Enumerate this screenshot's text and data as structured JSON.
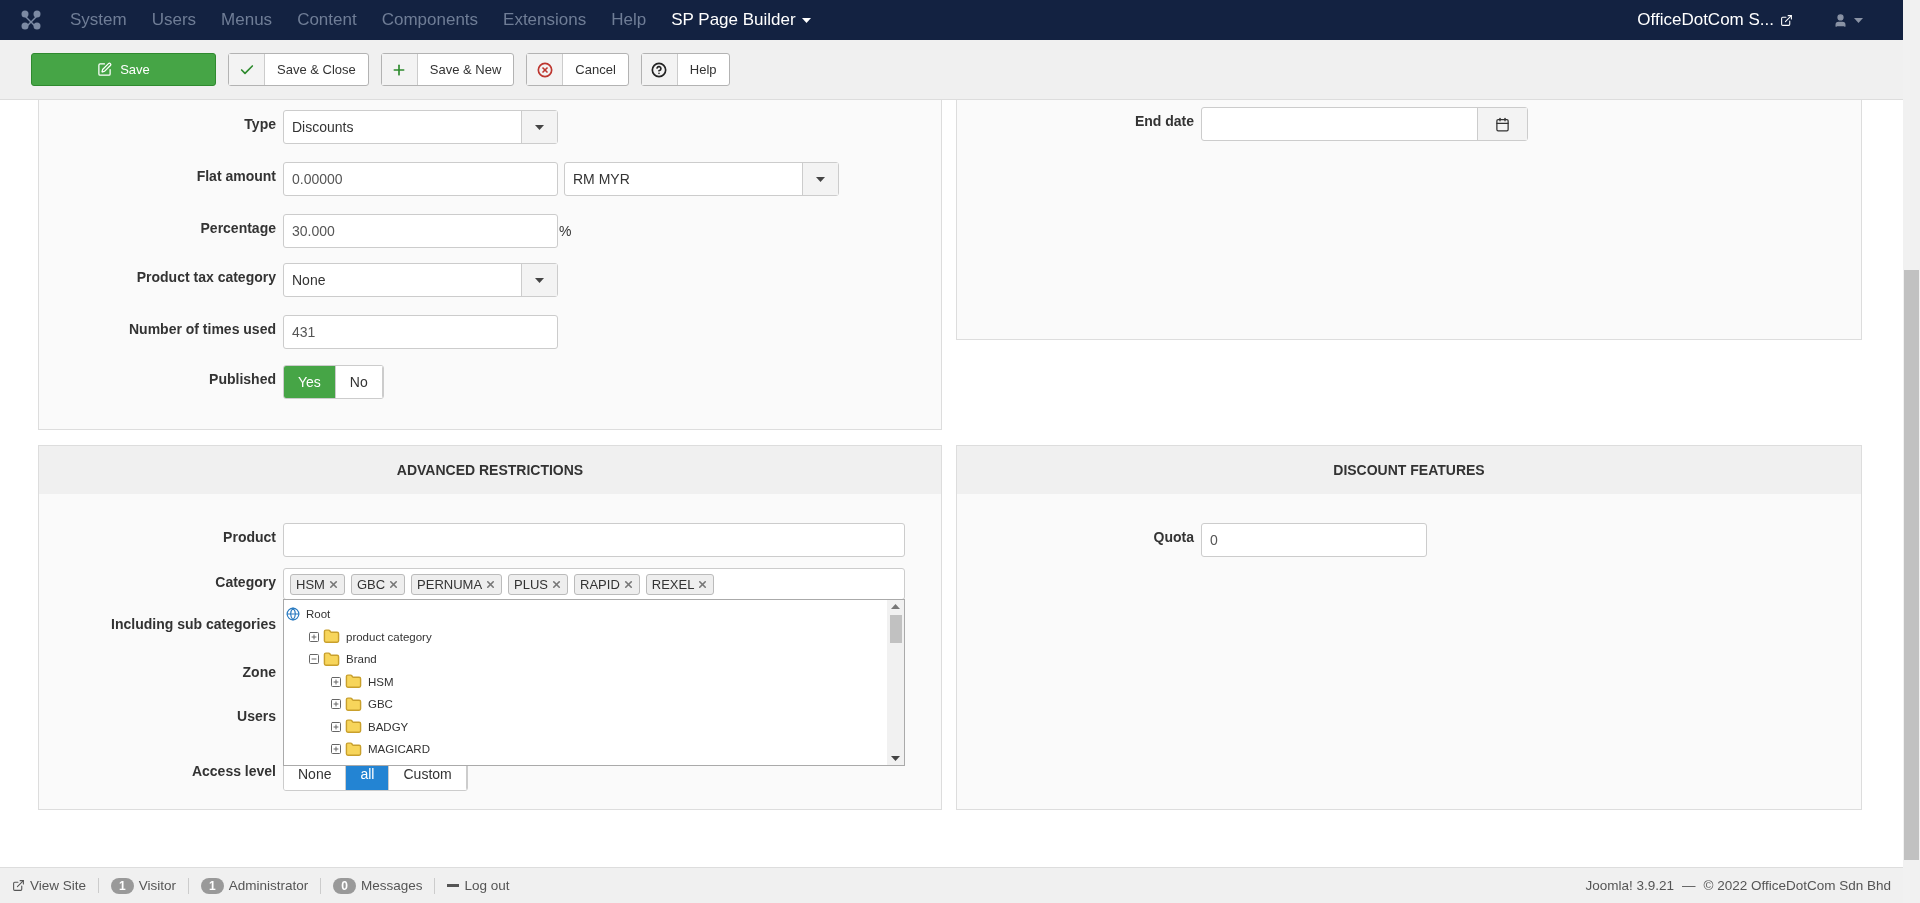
{
  "nav": {
    "menu": [
      {
        "label": "System",
        "disabled": true
      },
      {
        "label": "Users",
        "disabled": true
      },
      {
        "label": "Menus",
        "disabled": true
      },
      {
        "label": "Content",
        "disabled": true
      },
      {
        "label": "Components",
        "disabled": true
      },
      {
        "label": "Extensions",
        "disabled": true
      },
      {
        "label": "Help",
        "disabled": true
      },
      {
        "label": "SP Page Builder",
        "disabled": false
      }
    ],
    "site": "OfficeDotCom S..."
  },
  "toolbar": [
    {
      "kind": "primary",
      "label": "Save"
    },
    {
      "kind": "close",
      "label": "Save & Close"
    },
    {
      "kind": "new",
      "label": "Save & New"
    },
    {
      "kind": "cancel",
      "label": "Cancel"
    },
    {
      "kind": "help",
      "label": "Help"
    }
  ],
  "general": {
    "fields": [
      {
        "kind": "select",
        "label": "Type",
        "value": "Discounts"
      },
      {
        "kind": "amount",
        "label": "Flat amount",
        "value": "0.00000",
        "currency": "RM MYR"
      },
      {
        "kind": "percent",
        "label": "Percentage",
        "value": "30.000",
        "suffix": "%"
      },
      {
        "kind": "select",
        "label": "Product tax category",
        "value": "None"
      },
      {
        "kind": "text",
        "label": "Number of times used",
        "value": "431"
      },
      {
        "kind": "toggle",
        "label": "Published",
        "options": [
          {
            "label": "Yes",
            "selected": true
          },
          {
            "label": "No",
            "selected": false
          }
        ]
      }
    ]
  },
  "dates": {
    "end_date": {
      "label": "End date"
    }
  },
  "advanced": {
    "title": "ADVANCED RESTRICTIONS",
    "product": {
      "label": "Product"
    },
    "category": {
      "label": "Category",
      "tags": [
        "HSM",
        "GBC",
        "PERNUMA",
        "PLUS",
        "RAPID",
        "REXEL"
      ]
    },
    "hidden_labels": [
      "Including sub categories",
      "Zone",
      "Users"
    ],
    "access": {
      "label": "Access level",
      "options": [
        {
          "label": "None",
          "selected": false
        },
        {
          "label": "all",
          "selected": true
        },
        {
          "label": "Custom",
          "selected": false
        }
      ]
    },
    "tree": {
      "label": "Root",
      "children": [
        {
          "label": "product category",
          "expanded": false
        },
        {
          "label": "Brand",
          "expanded": true,
          "children": [
            {
              "label": "HSM",
              "expanded": false
            },
            {
              "label": "GBC",
              "expanded": false
            },
            {
              "label": "BADGY",
              "expanded": false
            },
            {
              "label": "MAGICARD",
              "expanded": false
            }
          ]
        }
      ]
    }
  },
  "features": {
    "title": "DISCOUNT FEATURES",
    "quota": {
      "label": "Quota",
      "value": "0"
    }
  },
  "status_bar": {
    "view_site": "View Site",
    "counters": [
      {
        "count": "1",
        "label": "Visitor"
      },
      {
        "count": "1",
        "label": "Administrator"
      },
      {
        "count": "0",
        "label": "Messages"
      }
    ],
    "logout": "Log out",
    "version": "Joomla! 3.9.21",
    "separator": "—",
    "copyright": "© 2022 OfficeDotCom Sdn Bhd"
  }
}
